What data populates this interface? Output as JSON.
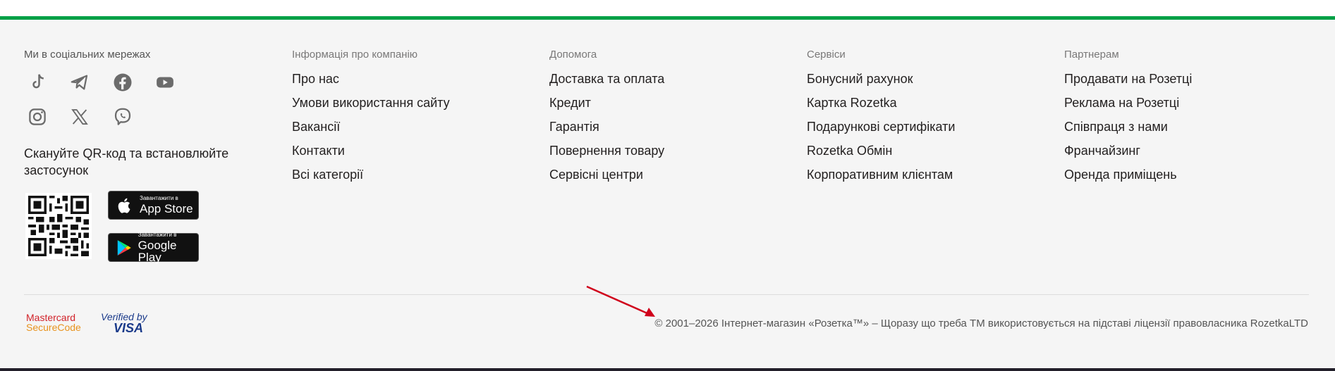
{
  "social": {
    "title": "Ми в соціальних мережах",
    "icons": [
      "tiktok-icon",
      "telegram-icon",
      "facebook-icon",
      "youtube-icon",
      "instagram-icon",
      "x-icon",
      "viber-icon"
    ]
  },
  "app": {
    "qr_text": "Скануйте QR-код та встановлюйте застосунок",
    "appstore_small": "Завантажити в",
    "appstore_big": "App Store",
    "googleplay_small": "Завантажити в",
    "googleplay_big": "Google Play"
  },
  "columns": [
    {
      "title": "Інформація про компанію",
      "links": [
        "Про нас",
        "Умови використання сайту",
        "Вакансії",
        "Контакти",
        "Всі категорії"
      ]
    },
    {
      "title": "Допомога",
      "links": [
        "Доставка та оплата",
        "Кредит",
        "Гарантія",
        "Повернення товару",
        "Сервісні центри"
      ]
    },
    {
      "title": "Сервіси",
      "links": [
        "Бонусний рахунок",
        "Картка Rozetka",
        "Подарункові сертифікати",
        "Rozetka Обмін",
        "Корпоративним клієнтам"
      ]
    },
    {
      "title": "Партнерам",
      "links": [
        "Продавати на Розетці",
        "Реклама на Розетці",
        "Співпраця з нами",
        "Франчайзинг",
        "Оренда приміщень"
      ]
    }
  ],
  "payments": {
    "mastercard_l1": "Mastercard",
    "mastercard_l2": "SecureCode",
    "visa_l1": "Verified by",
    "visa_l2": "VISA"
  },
  "copyright": "© 2001–2026 Інтернет-магазин «Розетка™» – Щоразу що треба ТМ використовується на підставі ліцензії правовласника RozetkaLTD",
  "colors": {
    "accent_green": "#00a046",
    "background": "#f5f5f5",
    "icon_gray": "#6b6b6b",
    "arrow_red": "#d0021b"
  }
}
